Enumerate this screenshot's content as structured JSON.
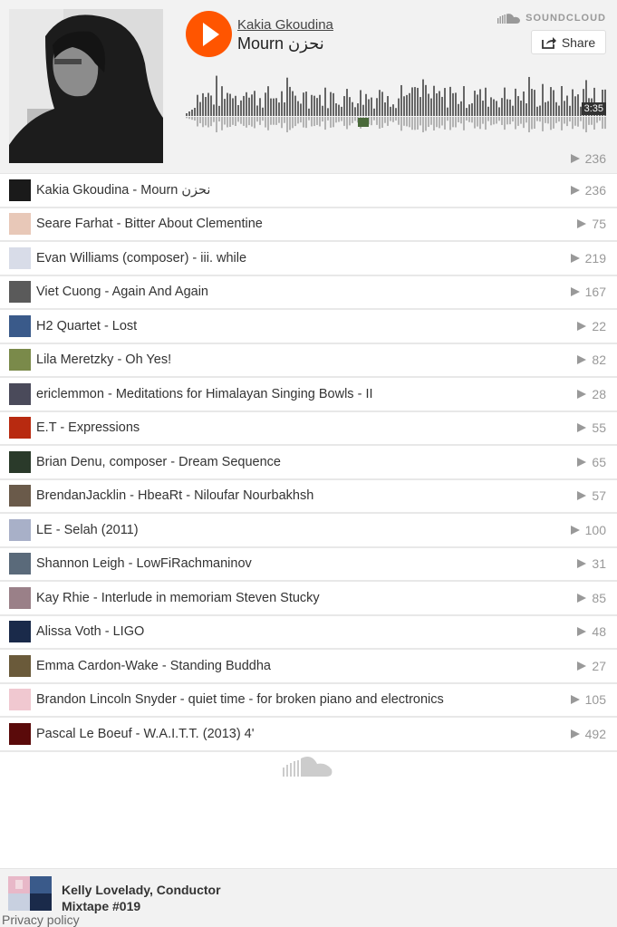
{
  "player": {
    "artist": "Kakia Gkoudina",
    "title": "Mourn نحزن",
    "brand": "SOUNDCLOUD",
    "share_label": "Share",
    "duration": "3:35",
    "plays": "236",
    "icons": {
      "play": "play-icon",
      "share": "share-icon",
      "brand": "soundcloud-logo-icon"
    }
  },
  "tracks": [
    {
      "label": "Kakia Gkoudina - Mourn نحزن",
      "plays": "236",
      "thumb": "#1a1a1a"
    },
    {
      "label": "Seare Farhat - Bitter About Clementine",
      "plays": "75",
      "thumb": "#e8c8b8"
    },
    {
      "label": "Evan Williams (composer) - iii. while",
      "plays": "219",
      "thumb": "#d8dce8"
    },
    {
      "label": "Viet Cuong - Again And Again",
      "plays": "167",
      "thumb": "#5a5a5a"
    },
    {
      "label": "H2 Quartet - Lost",
      "plays": "22",
      "thumb": "#3a5a8a"
    },
    {
      "label": "Lila Meretzky - Oh Yes!",
      "plays": "82",
      "thumb": "#7a8a4a"
    },
    {
      "label": "ericlemmon - Meditations for Himalayan Singing Bowls - II",
      "plays": "28",
      "thumb": "#4a4a5a"
    },
    {
      "label": "E.T - Expressions",
      "plays": "55",
      "thumb": "#b82a10"
    },
    {
      "label": "Brian Denu, composer - Dream Sequence",
      "plays": "65",
      "thumb": "#2a3a2a"
    },
    {
      "label": "BrendanJacklin - HbeaRt - Niloufar Nourbakhsh",
      "plays": "57",
      "thumb": "#6a5a4a"
    },
    {
      "label": "LE - Selah (2011)",
      "plays": "100",
      "thumb": "#a8b0c8"
    },
    {
      "label": "Shannon Leigh - LowFiRachmaninov",
      "plays": "31",
      "thumb": "#5a6a7a"
    },
    {
      "label": "Kay Rhie - Interlude in memoriam Steven Stucky",
      "plays": "85",
      "thumb": "#9a8088"
    },
    {
      "label": "Alissa Voth - LIGO",
      "plays": "48",
      "thumb": "#1a2a4a"
    },
    {
      "label": "Emma Cardon-Wake - Standing Buddha",
      "plays": "27",
      "thumb": "#6a5a3a"
    },
    {
      "label": "Brandon Lincoln Snyder - quiet time - for broken piano and electronics",
      "plays": "105",
      "thumb": "#f0c8d0"
    },
    {
      "label": "Pascal Le Boeuf - W.A.I.T.T. (2013) 4'",
      "plays": "492",
      "thumb": "#5a0a0a"
    }
  ],
  "footer": {
    "user": "Kelly Lovelady, Conductor",
    "playlist": "Mixtape #019",
    "privacy": "Privacy policy"
  }
}
